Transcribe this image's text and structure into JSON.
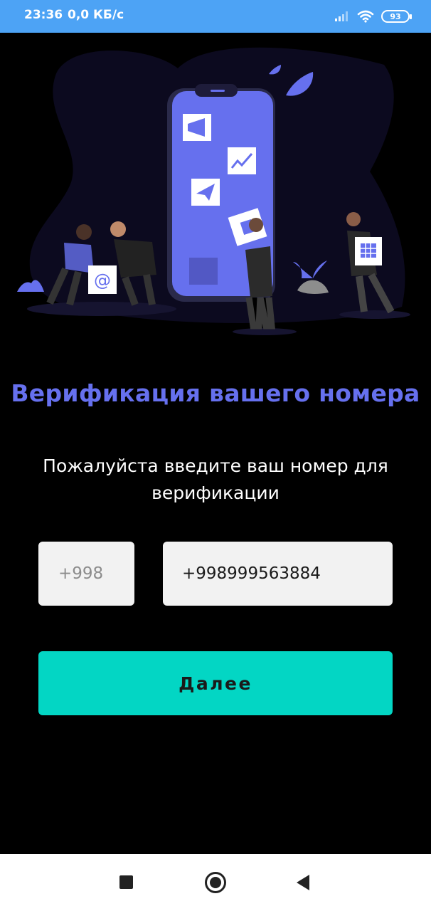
{
  "status_bar": {
    "time": "23:36",
    "network_speed": "0,0 КБ/с",
    "battery_level": "93",
    "icons": [
      "signal-icon",
      "wifi-icon",
      "battery-icon"
    ]
  },
  "main": {
    "title": "Верификация вашего номера",
    "subtitle": "Пожалуйста введите ваш номер для верификации",
    "country_code": {
      "value": "+998"
    },
    "phone": {
      "value": "+998999563884"
    },
    "next_button_label": "Далее"
  },
  "nav_bar": {
    "icons": [
      "recents-icon",
      "home-icon",
      "back-icon"
    ]
  },
  "colors": {
    "status_bar": "#4da3f5",
    "background": "#000000",
    "accent": "#6670ee",
    "button": "#03d6c4",
    "input_background": "#f2f2f2"
  }
}
